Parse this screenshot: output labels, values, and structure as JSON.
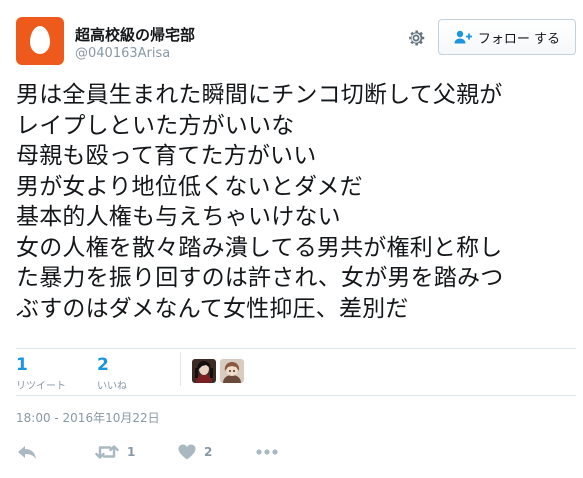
{
  "user": {
    "display_name": "超高校級の帰宅部",
    "screen_name": "@040163Arisa"
  },
  "header": {
    "follow_label": "フォロー する"
  },
  "tweet": {
    "lines": [
      "男は全員生まれた瞬間にチンコ切断して父親が",
      "レイプしといた方がいいな",
      "母親も殴って育てた方がいい",
      "男が女より地位低くないとダメだ",
      "基本的人権も与えちゃいけない",
      "女の人権を散々踏み潰してる男共が権利と称し",
      "た暴力を振り回すのは許され、女が男を踏みつ",
      "ぶすのはダメなんて女性抑圧、差別だ"
    ],
    "timestamp": "18:00 - 2016年10月22日"
  },
  "stats": {
    "retweets": {
      "count": "1",
      "label": "リツイート"
    },
    "likes": {
      "count": "2",
      "label": "いいね"
    }
  },
  "actions": {
    "reply": {
      "icon": "reply-icon"
    },
    "retweet": {
      "icon": "retweet-icon",
      "count": "1"
    },
    "like": {
      "icon": "heart-icon",
      "count": "2"
    },
    "more": {
      "icon": "more-icon"
    }
  },
  "colors": {
    "avatar_bg": "#ee5a1c",
    "stat_number": "#1b95e0",
    "muted": "#8899a6",
    "divider": "#e1e8ed"
  }
}
